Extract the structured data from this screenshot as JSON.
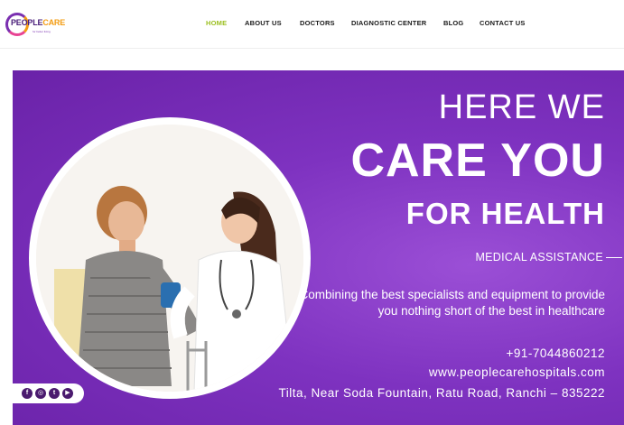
{
  "header": {
    "logo": {
      "word_part1": "PEOPLE",
      "word_part2": "CARE",
      "tagline": "for better living"
    },
    "nav": [
      {
        "label": "HOME",
        "active": true
      },
      {
        "label": "ABOUT US",
        "active": false
      },
      {
        "label": "DOCTORS",
        "active": false
      },
      {
        "label": "DIAGNOSTIC CENTER",
        "active": false
      },
      {
        "label": "BLOG",
        "active": false
      },
      {
        "label": "CONTACT US",
        "active": false
      }
    ],
    "colors": {
      "nav_active": "#9bbf1f",
      "nav_text": "#1a1a1a"
    }
  },
  "hero": {
    "headline_line1": "HERE WE",
    "headline_line2": "CARE YOU",
    "headline_line3": "FOR HEALTH",
    "section_label": "MEDICAL ASSISTANCE",
    "description": "Combining the best specialists and equipment to provide you nothing short of the best in healthcare",
    "phone": "+91-7044860212",
    "website": "www.peoplecarehospitals.com",
    "address": "Tilta, Near Soda Fountain, Ratu Road, Ranchi – 835222",
    "photo_alt": "doctor-with-elderly-patient",
    "colors": {
      "background": "#7e32c0",
      "text": "#ffffff"
    }
  },
  "social": [
    {
      "icon": "facebook-icon",
      "glyph": "f"
    },
    {
      "icon": "instagram-icon",
      "glyph": "◎"
    },
    {
      "icon": "twitter-icon",
      "glyph": "t"
    },
    {
      "icon": "youtube-icon",
      "glyph": "▶"
    }
  ]
}
